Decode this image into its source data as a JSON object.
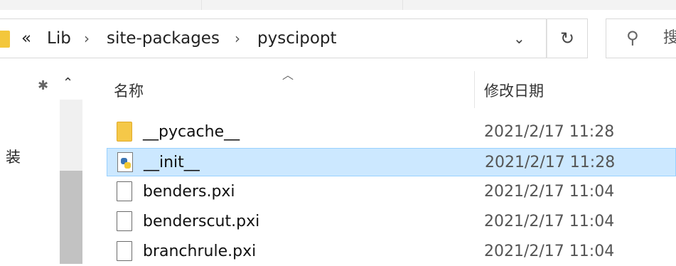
{
  "address_bar": {
    "overflow": "«",
    "crumbs": [
      "Lib",
      "site-packages",
      "pyscipopt"
    ]
  },
  "search": {
    "placeholder": "搜"
  },
  "nav": {
    "visible_text": "装"
  },
  "columns": {
    "name": "名称",
    "date_modified": "修改日期"
  },
  "files": [
    {
      "name": "__pycache__",
      "date": "2021/2/17 11:28",
      "type": "folder"
    },
    {
      "name": "__init__",
      "date": "2021/2/17 11:28",
      "type": "python",
      "selected": true
    },
    {
      "name": "benders.pxi",
      "date": "2021/2/17 11:04",
      "type": "file"
    },
    {
      "name": "benderscut.pxi",
      "date": "2021/2/17 11:04",
      "type": "file"
    },
    {
      "name": "branchrule.pxi",
      "date": "2021/2/17 11:04",
      "type": "file"
    }
  ],
  "colors": {
    "selection": "#cce8ff",
    "selection_border": "#99d1ff",
    "folder": "#f5c848"
  }
}
